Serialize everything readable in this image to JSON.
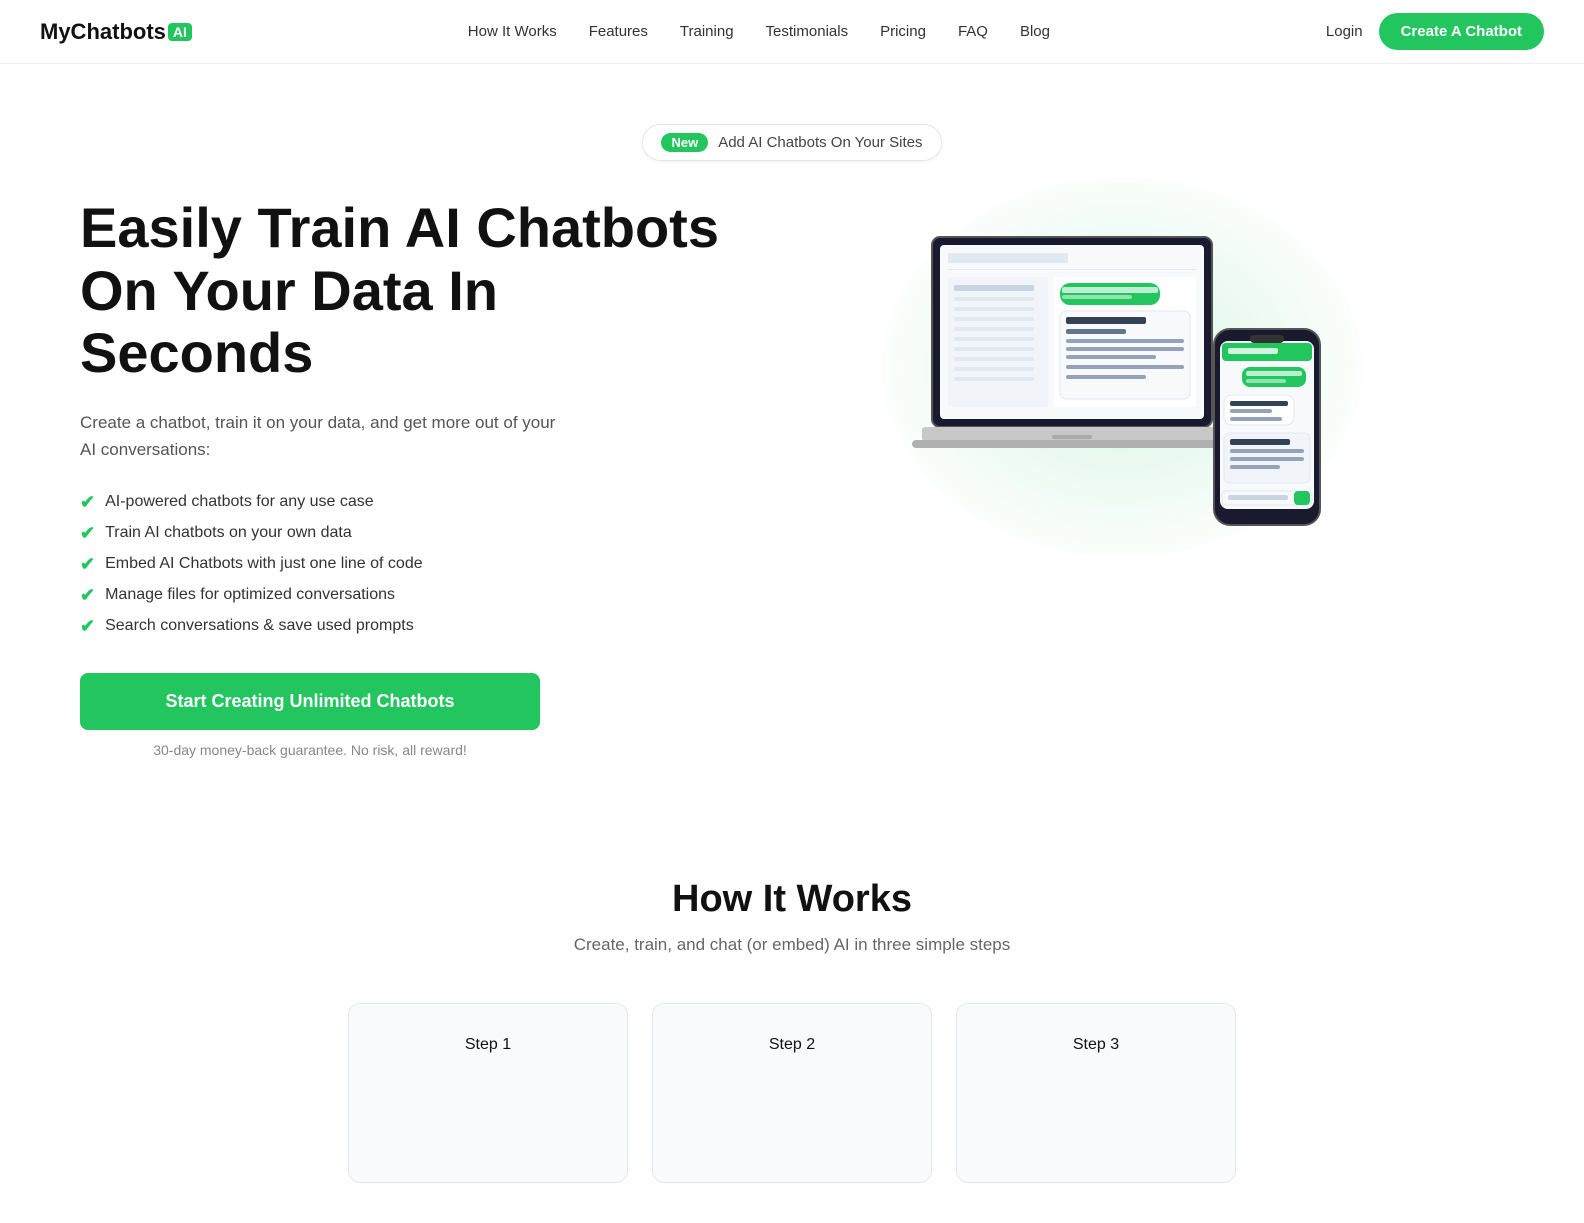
{
  "brand": {
    "name": "MyChatbots",
    "ai_badge": "AI",
    "logo_color": "#22c55e"
  },
  "navbar": {
    "links": [
      {
        "id": "how-it-works",
        "label": "How It Works"
      },
      {
        "id": "features",
        "label": "Features"
      },
      {
        "id": "training",
        "label": "Training"
      },
      {
        "id": "testimonials",
        "label": "Testimonials"
      },
      {
        "id": "pricing",
        "label": "Pricing"
      },
      {
        "id": "faq",
        "label": "FAQ"
      },
      {
        "id": "blog",
        "label": "Blog"
      }
    ],
    "login_label": "Login",
    "cta_label": "Create A Chatbot"
  },
  "hero": {
    "badge_new": "New",
    "badge_text": "Add AI Chatbots On Your Sites",
    "title": "Easily Train AI Chatbots On Your Data In Seconds",
    "description": "Create a chatbot, train it on your data, and get more out of your AI conversations:",
    "features": [
      "AI-powered chatbots for any use case",
      "Train AI chatbots on your own data",
      "Embed AI Chatbots with just one line of code",
      "Manage files for optimized conversations",
      "Search conversations & save used prompts"
    ],
    "cta_button": "Start Creating Unlimited Chatbots",
    "guarantee": "30-day money-back guarantee. No risk, all reward!"
  },
  "how_it_works": {
    "title": "How It Works",
    "subtitle": "Create, train, and chat (or embed) AI in three simple steps",
    "steps": [
      {
        "label": "Step 1"
      },
      {
        "label": "Step 2"
      },
      {
        "label": "Step 3"
      }
    ]
  }
}
